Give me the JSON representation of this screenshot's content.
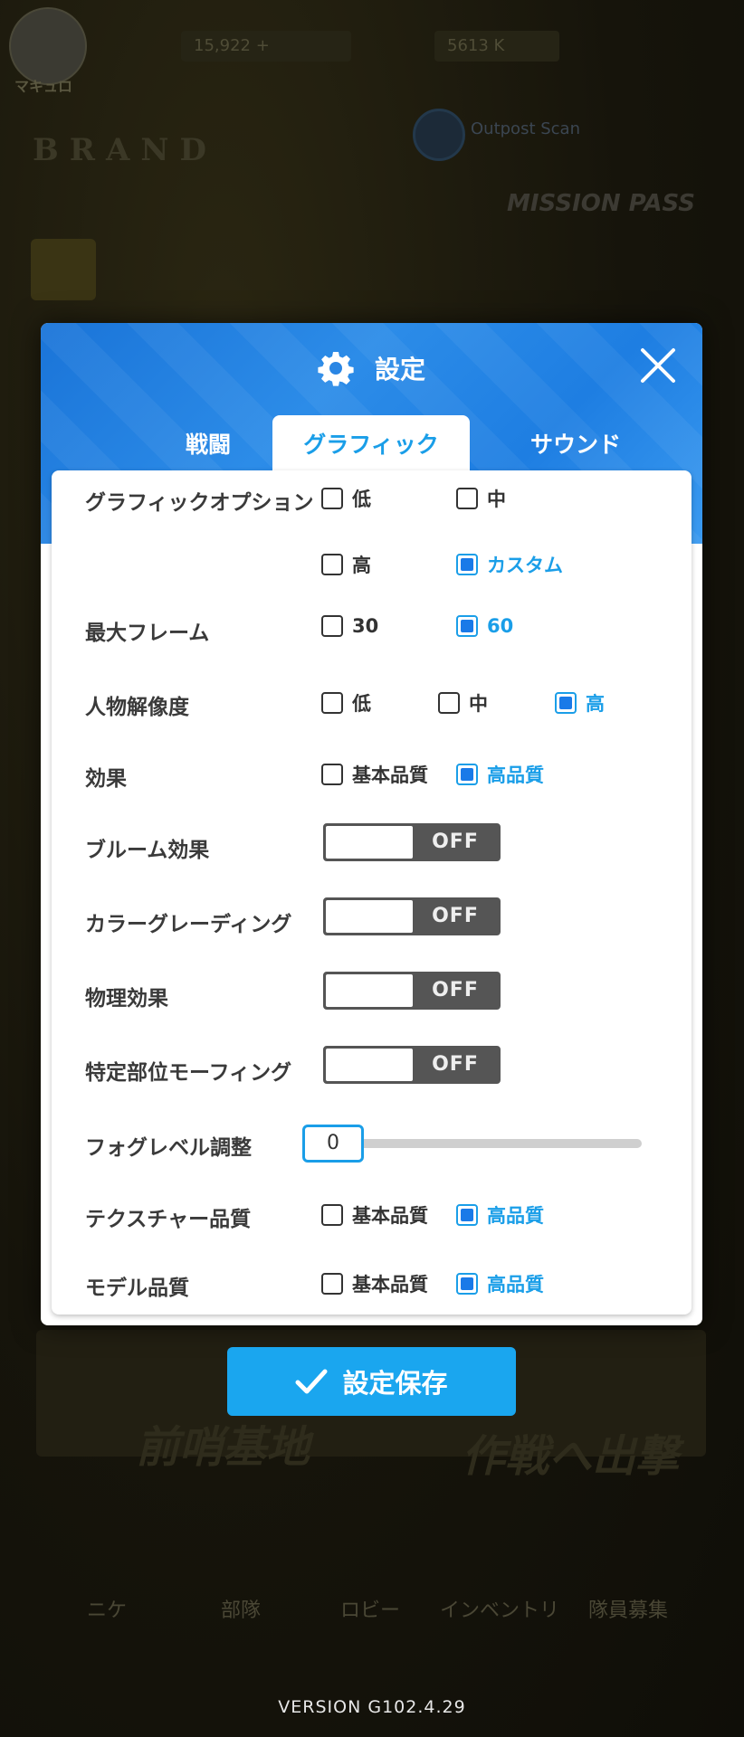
{
  "background": {
    "player_name": "マキュロ",
    "resource_1": "15,922 +",
    "resource_2": "5613 K",
    "brand_text": "BRAND",
    "alert_text": "Outpost Scan",
    "pass_text": "MISSION PASS",
    "outpost_text": "前哨基地",
    "sortie_text": "作戦へ出撃",
    "nav_items": [
      "ニケ",
      "部隊",
      "ロビー",
      "インベントリ",
      "隊員募集"
    ]
  },
  "modal": {
    "title": "設定",
    "tabs": [
      "戦闘",
      "グラフィック",
      "サウンド"
    ],
    "active_tab": "グラフィック",
    "rows": {
      "graphic_option": {
        "label": "グラフィックオプション",
        "options": [
          "低",
          "中",
          "高",
          "カスタム"
        ],
        "selected": "カスタム"
      },
      "max_frame": {
        "label": "最大フレーム",
        "options": [
          "30",
          "60"
        ],
        "selected": "60"
      },
      "character_resolution": {
        "label": "人物解像度",
        "options": [
          "低",
          "中",
          "高"
        ],
        "selected": "高"
      },
      "effects": {
        "label": "効果",
        "options": [
          "基本品質",
          "高品質"
        ],
        "selected": "高品質"
      },
      "bloom": {
        "label": "ブルーム効果",
        "state": "OFF"
      },
      "color_grading": {
        "label": "カラーグレーディング",
        "state": "OFF"
      },
      "physics": {
        "label": "物理効果",
        "state": "OFF"
      },
      "morphing": {
        "label": "特定部位モーフィング",
        "state": "OFF"
      },
      "fog_level": {
        "label": "フォグレベル調整",
        "value": "0"
      },
      "texture_quality": {
        "label": "テクスチャー品質",
        "options": [
          "基本品質",
          "高品質"
        ],
        "selected": "高品質"
      },
      "model_quality": {
        "label": "モデル品質",
        "options": [
          "基本品質",
          "高品質"
        ],
        "selected": "高品質"
      }
    }
  },
  "save_button": {
    "label": "設定保存"
  },
  "version": "VERSION   G102.4.29",
  "colors": {
    "accent": "#1a9ee8",
    "header_blue": "#1e7ee2",
    "save_button": "#1aa6ef",
    "toggle_off": "#555555"
  }
}
